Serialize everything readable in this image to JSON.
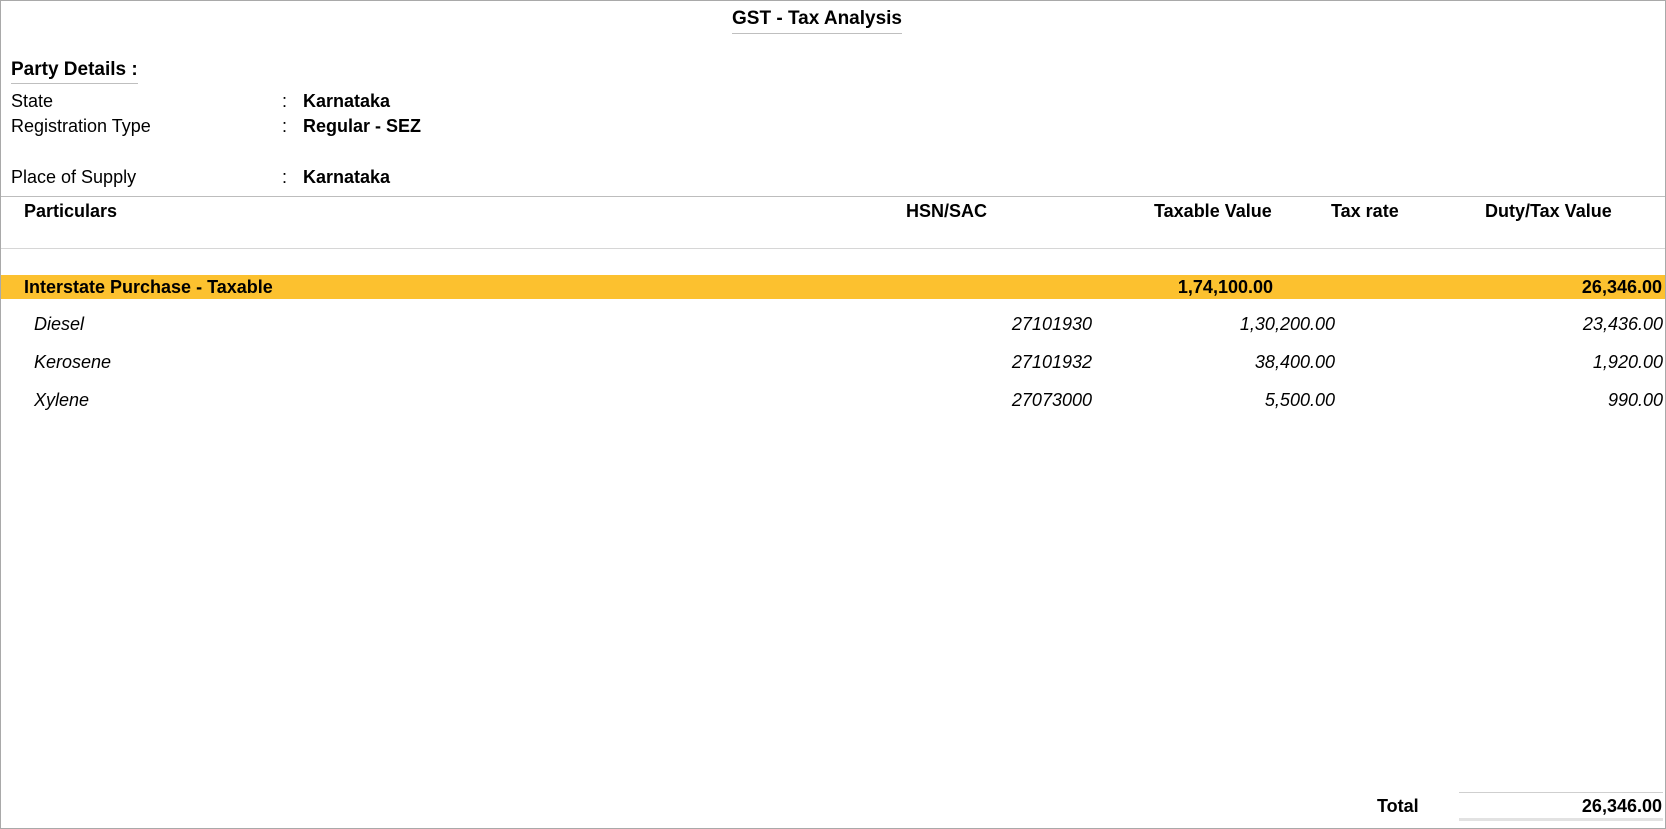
{
  "report": {
    "title": "GST - Tax Analysis"
  },
  "party_details": {
    "heading": "Party Details :",
    "fields": [
      {
        "label": "State",
        "value": "Karnataka"
      },
      {
        "label": "Registration Type",
        "value": "Regular - SEZ"
      },
      {
        "label": "Place of Supply",
        "value": "Karnataka"
      }
    ],
    "separator": ":"
  },
  "table": {
    "columns": {
      "particulars": "Particulars",
      "hsn_sac": "HSN/SAC",
      "taxable_value": "Taxable Value",
      "tax_rate": "Tax rate",
      "duty_tax_value": "Duty/Tax Value"
    },
    "group": {
      "name": "Interstate Purchase - Taxable",
      "taxable_value": "1,74,100.00",
      "duty_tax_value": "26,346.00"
    },
    "rows": [
      {
        "name": "Diesel",
        "hsn_sac": "27101930",
        "taxable_value": "1,30,200.00",
        "duty_tax_value": "23,436.00"
      },
      {
        "name": "Kerosene",
        "hsn_sac": "27101932",
        "taxable_value": "38,400.00",
        "duty_tax_value": "1,920.00"
      },
      {
        "name": "Xylene",
        "hsn_sac": "27073000",
        "taxable_value": "5,500.00",
        "duty_tax_value": "990.00"
      }
    ]
  },
  "footer": {
    "total_label": "Total",
    "total_value": "26,346.00"
  },
  "colors": {
    "group_highlight": "#fcc12f",
    "border": "#a9a9a9"
  }
}
